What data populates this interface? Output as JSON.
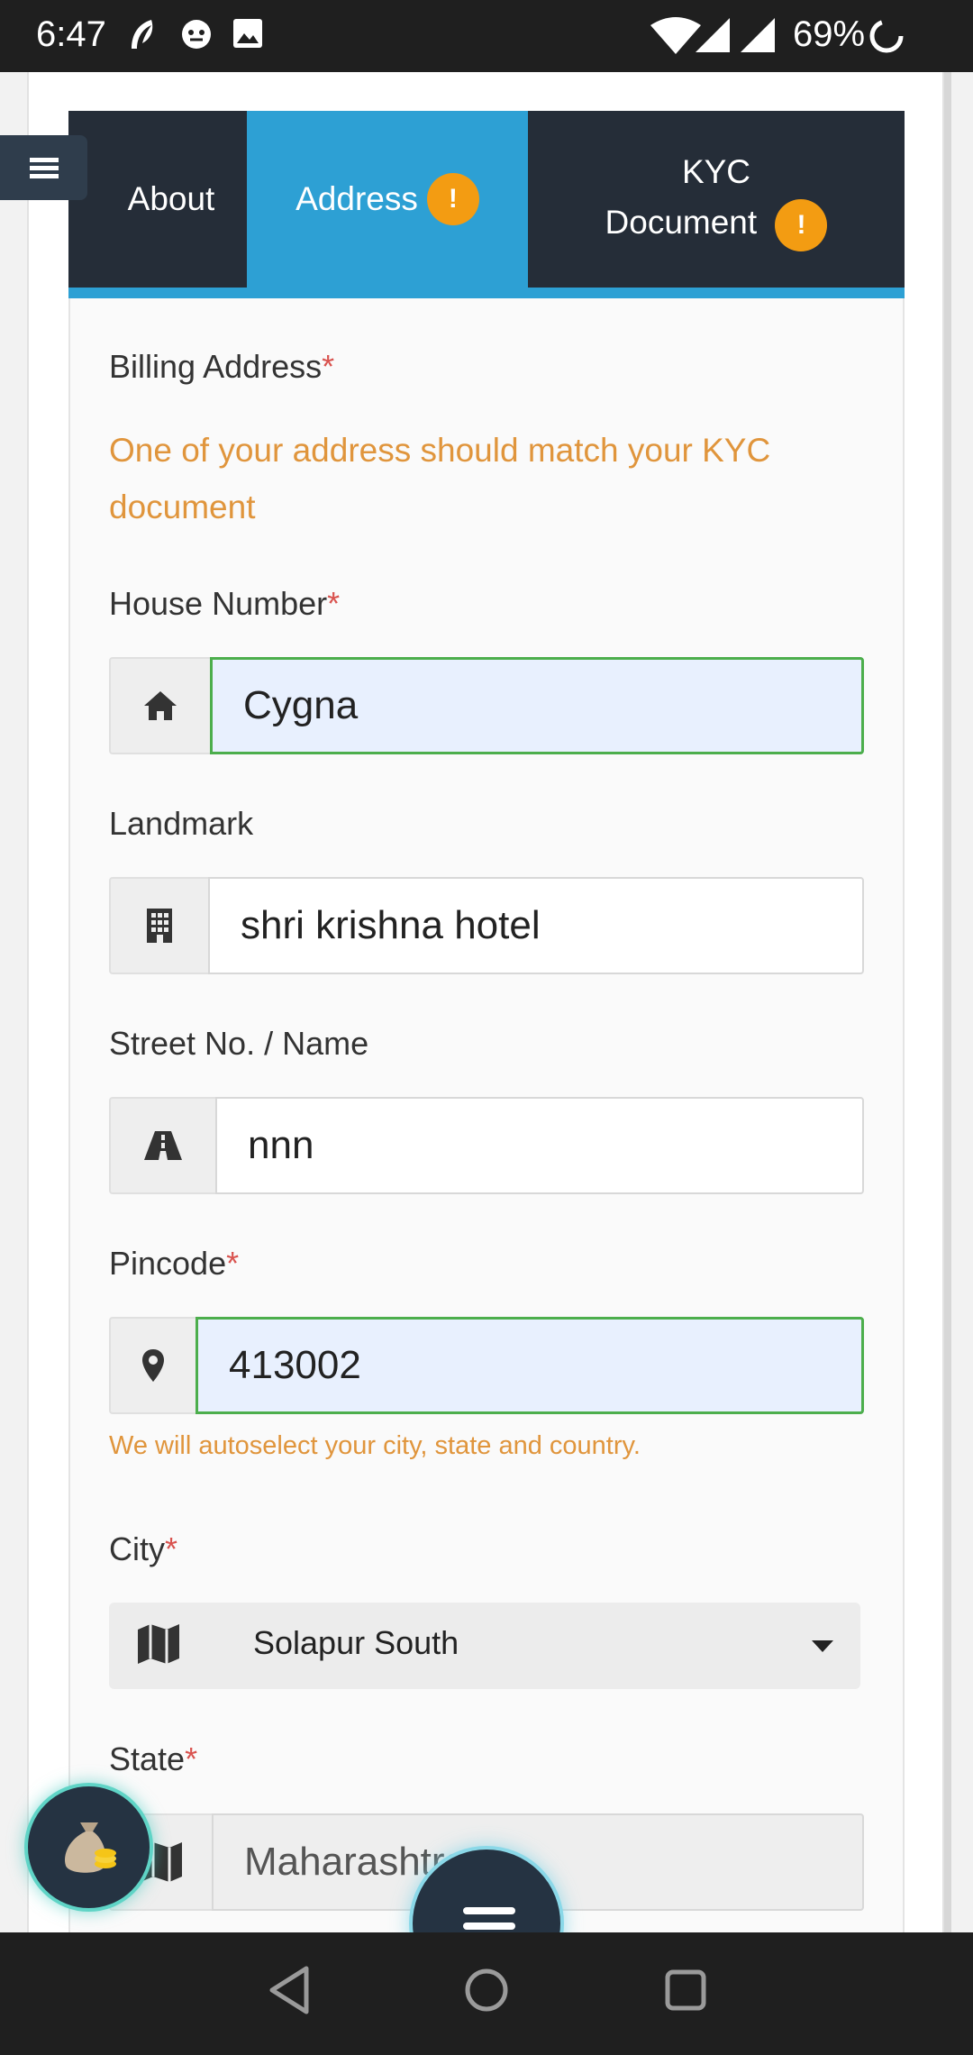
{
  "status_bar": {
    "time": "6:47",
    "battery": "69%",
    "icons": [
      "feather-icon",
      "cat-icon",
      "image-icon",
      "wifi-icon",
      "signal-icon",
      "signal-icon",
      "battery-ring-icon"
    ]
  },
  "tabs": {
    "about": "About",
    "address": "Address",
    "kyc_line1": "KYC",
    "kyc_line2": "Document",
    "badge": "!"
  },
  "form": {
    "billing_label": "Billing Address",
    "required_mark": "*",
    "billing_hint": "One of your address should match your KYC document",
    "house_label": "House Number",
    "house_value": "Cygna",
    "landmark_label": "Landmark",
    "landmark_value": "shri krishna hotel",
    "street_label": "Street No. / Name",
    "street_value": "nnn",
    "pincode_label": "Pincode",
    "pincode_value": "413002",
    "pincode_hint": "We will autoselect your city, state and country.",
    "city_label": "City",
    "city_value": "Solapur South",
    "state_label": "State",
    "state_value": "Maharashtra"
  },
  "colors": {
    "tab_bg": "#252d38",
    "tab_active": "#2da0d4",
    "badge": "#f39c12",
    "hint": "#e0953c",
    "required": "#d9534f",
    "valid_border": "#4cae4c"
  }
}
